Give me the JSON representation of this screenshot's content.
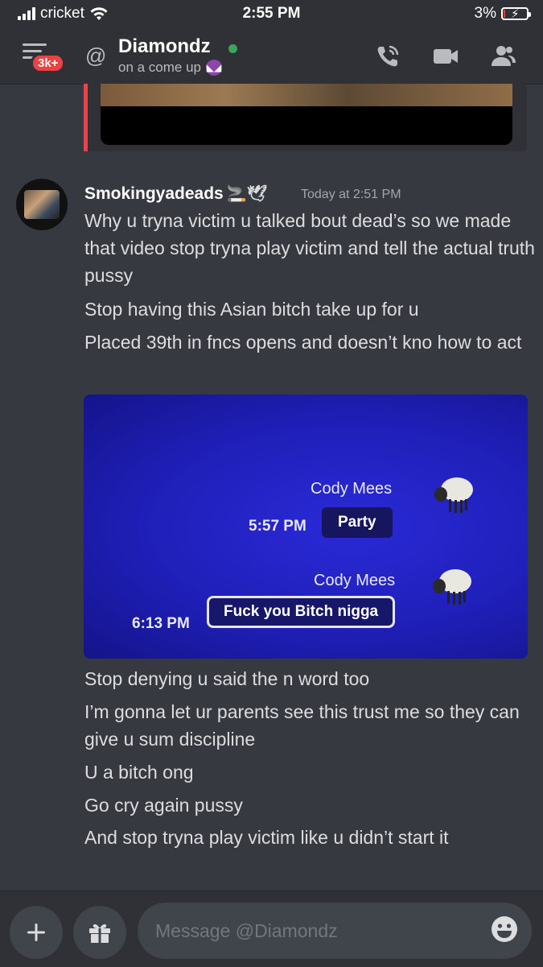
{
  "status_bar": {
    "carrier": "cricket",
    "time": "2:55 PM",
    "battery": "3%"
  },
  "header": {
    "unread_badge": "3k+",
    "at_symbol": "@",
    "name": "Diamondz",
    "status_text": "on a come up",
    "status_color": "#3ba55c",
    "icons": [
      "menu-icon",
      "call-icon",
      "video-icon",
      "members-icon"
    ]
  },
  "message": {
    "author": "Smokingyadeads",
    "author_emojis": "🚬🕊",
    "timestamp": "Today at 2:51 PM",
    "lines_before_image": [
      "Why u tryna victim u talked bout dead’s so we made that video stop tryna play victim and tell the actual truth pussy",
      "Stop having this Asian bitch take up for u",
      "Placed 39th in fncs opens and doesn’t kno how to act"
    ],
    "attachment": {
      "messages": [
        {
          "name": "Cody Mees",
          "time": "5:57 PM",
          "text": "Party"
        },
        {
          "name": "Cody Mees",
          "time": "6:13 PM",
          "text": "Fuck you Bitch nigga"
        }
      ]
    },
    "lines_after_image": [
      "Stop denying u said the n word too",
      "I’m gonna let ur parents see this trust me so they can give u sum discipline",
      "U a bitch ong",
      "Go cry again pussy",
      "And stop tryna play victim like u didn’t start it"
    ]
  },
  "input_bar": {
    "placeholder": "Message @Diamondz",
    "add_icon": "plus-icon",
    "gift_icon": "gift-icon",
    "emoji_icon": "smiley-icon"
  },
  "colors": {
    "background": "#36393f",
    "header": "#2f3136",
    "badge": "#ed4245",
    "embed_border": "#ed4245"
  }
}
